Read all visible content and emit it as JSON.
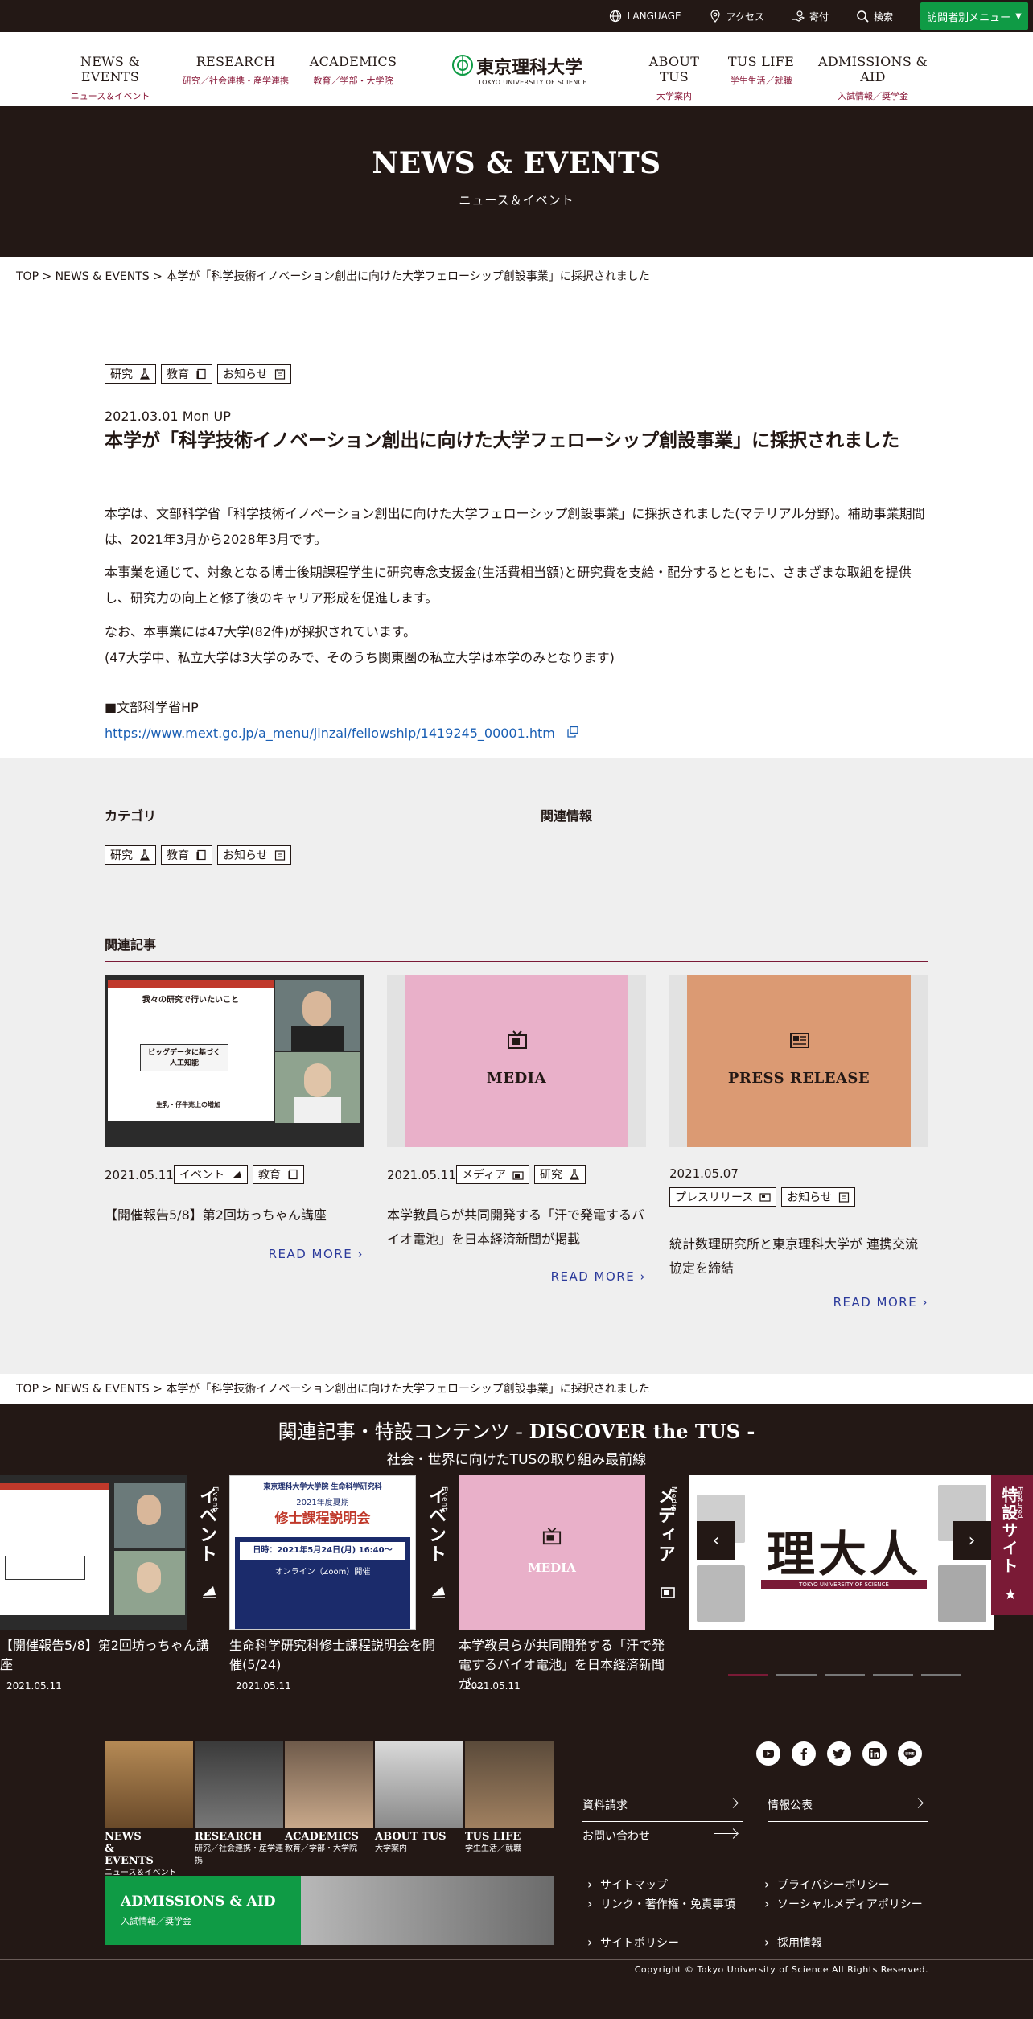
{
  "utility": {
    "language": "LANGUAGE",
    "access": "アクセス",
    "donation": "寄付",
    "search": "検索",
    "visitor_menu": "訪問者別メニュー"
  },
  "header": {
    "nav_left": [
      {
        "en": "NEWS & EVENTS",
        "jp": "ニュース＆イベント"
      },
      {
        "en": "RESEARCH",
        "jp": "研究／社会連携・産学連携"
      },
      {
        "en": "ACADEMICS",
        "jp": "教育／学部・大学院"
      }
    ],
    "nav_right": [
      {
        "en": "ABOUT TUS",
        "jp": "大学案内"
      },
      {
        "en": "TUS LIFE",
        "jp": "学生生活／就職"
      },
      {
        "en": "ADMISSIONS & AID",
        "jp": "入試情報／奨学金"
      }
    ],
    "logo_name": "東京理科大学",
    "logo_sub": "TOKYO UNIVERSITY OF SCIENCE"
  },
  "hero": {
    "title": "NEWS & EVENTS",
    "subtitle": "ニュース＆イベント"
  },
  "breadcrumb": "TOP > NEWS & EVENTS > 本学が「科学技術イノベーション創出に向けた大学フェローシップ創設事業」に採択されました",
  "article": {
    "tags": [
      "研究",
      "教育",
      "お知らせ"
    ],
    "date": "2021.03.01 Mon UP",
    "title": "本学が「科学技術イノベーション創出に向けた大学フェローシップ創設事業」に採択されました",
    "paragraphs": [
      "本学は、文部科学省「科学技術イノベーション創出に向けた大学フェローシップ創設事業」に採択されました(マテリアル分野)。補助事業期間は、2021年3月から2028年3月です。",
      "本事業を通じて、対象となる博士後期課程学生に研究専念支援金(生活費相当額)と研究費を支給・配分するとともに、さまざまな取組を提供し、研究力の向上と修了後のキャリア形成を促進します。",
      "なお、本事業には47大学(82件)が採択されています。",
      "(47大学中、私立大学は3大学のみで、そのうち関東圏の私立大学は本学のみとなります)"
    ],
    "hp_label": "■文部科学省HP",
    "hp_url": "https://www.mext.go.jp/a_menu/jinzai/fellowship/1419245_00001.htm"
  },
  "category": {
    "heading": "カテゴリ",
    "tags": [
      "研究",
      "教育",
      "お知らせ"
    ]
  },
  "related_info": {
    "heading": "関連情報"
  },
  "related_articles": {
    "heading": "関連記事",
    "read_more": "READ MORE",
    "items": [
      {
        "date": "2021.05.11",
        "tags": [
          "イベント",
          "教育"
        ],
        "title": "【開催報告5/8】第2回坊っちゃん講座",
        "slide_text": [
          "我々の研究で行いたいこと",
          "ビッグデータに基づく",
          "人工知能",
          "生乳・仔牛売上の増加"
        ]
      },
      {
        "date": "2021.05.11",
        "tags": [
          "メディア",
          "研究"
        ],
        "title": "本学教員らが共同開発する「汗で発電するバイオ電池」を日本経済新聞が掲載",
        "placeholder": "MEDIA"
      },
      {
        "date": "2021.05.07",
        "tags": [
          "プレスリリース",
          "お知らせ"
        ],
        "title": "統計数理研究所と東京理科大学が 連携交流協定を締結",
        "placeholder": "PRESS RELEASE"
      }
    ]
  },
  "discover": {
    "title_jp": "関連記事・特設コンテンツ - ",
    "title_en": "DISCOVER the TUS -",
    "subtitle": "社会・世界に向けたTUSの取り組み最前線",
    "slides": [
      {
        "label_jp": "イベント",
        "label_en": "Event",
        "caption": "【開催報告5/8】第2回坊っちゃん講座",
        "date": "2021.05.11"
      },
      {
        "label_jp": "イベント",
        "label_en": "Event",
        "caption": "生命科学研究科修士課程説明会を開催(5/24)",
        "date": "2021.05.11",
        "poster": {
          "l1": "東京理科大学大学院 生命科学研究科",
          "l2": "2021年度夏期",
          "l3": "修士課程説明会",
          "l4": "日時：2021年5月24日(月) 16:40〜",
          "l5": "オンライン（Zoom）開催"
        }
      },
      {
        "label_jp": "メディア",
        "label_en": "Media",
        "caption": "本学教員らが共同開発する「汗で発電するバイオ電池」を日本経済新聞が…",
        "date": "2021.05.11",
        "placeholder": "MEDIA"
      },
      {
        "label_jp": "特設サイト",
        "label_en": "Featured",
        "banner": "理大人",
        "banner_sub": "TOKYO UNIVERSITY OF SCIENCE"
      }
    ]
  },
  "footer": {
    "tiles": [
      {
        "en": "NEWS & EVENTS",
        "jp": "ニュース＆イベント"
      },
      {
        "en": "RESEARCH",
        "jp": "研究／社会連携・産学連携"
      },
      {
        "en": "ACADEMICS",
        "jp": "教育／学部・大学院"
      },
      {
        "en": "ABOUT TUS",
        "jp": "大学案内"
      },
      {
        "en": "TUS LIFE",
        "jp": "学生生活／就職"
      }
    ],
    "admissions_en": "ADMISSIONS & AID",
    "admissions_jp": "入試情報／奨学金",
    "social": [
      "youtube-icon",
      "facebook-icon",
      "twitter-icon",
      "linkedin-icon",
      "line-icon"
    ],
    "line_text": "LINE",
    "links": [
      "資料請求",
      "お問い合わせ",
      "情報公表"
    ],
    "sublinks": [
      "サイトマップ",
      "リンク・著作権・免責事項",
      "サイトポリシー",
      "プライバシーポリシー",
      "ソーシャルメディアポリシー",
      "採用情報"
    ],
    "copyright": "Copyright © Tokyo University of Science All Rights Reserved."
  },
  "colors": {
    "dark": "#231815",
    "accent": "#8a1a3a",
    "green": "#0f9b45",
    "media_pink": "#e9b0c9",
    "press_orange": "#db9a73",
    "link": "#1a5fb4"
  }
}
